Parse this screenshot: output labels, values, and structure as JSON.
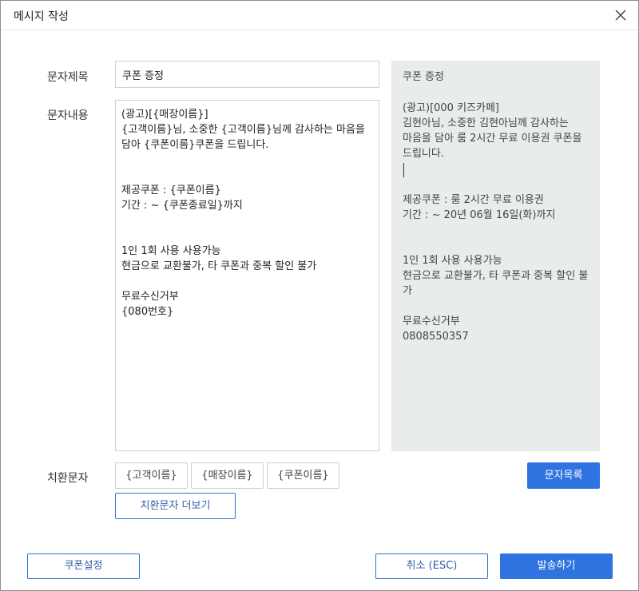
{
  "window": {
    "title": "메시지 작성"
  },
  "form": {
    "subject_label": "문자제목",
    "subject_value": "쿠폰 증정",
    "content_label": "문자내용",
    "content_value": "(광고)[{매장이름}]\n{고객이름}님, 소중한 {고객이름}님께 감사하는 마음을 담아 {쿠폰이름}쿠폰을 드립니다.\n\n\n제공쿠폰 : {쿠폰이름}\n기간 : ~ {쿠폰종료일}까지\n\n\n1인 1회 사용 사용가능\n현금으로 교환불가, 타 쿠폰과 중복 할인 불가\n\n무료수신거부\n{080번호}"
  },
  "preview": {
    "title": "쿠폰 증정",
    "body": "(광고)[000 키즈카페]\n김현아님, 소중한 김현아님께 감사하는 마음을 담아 룸 2시간 무료 이용권 쿠폰을 드립니다.",
    "after": "\n제공쿠폰 : 룸 2시간 무료 이용권\n기간 : ~ 20년 06월 16일(화)까지\n\n\n1인 1회 사용 사용가능\n현금으로 교환불가, 타 쿠폰과 중복 할인 불가\n\n무료수신거부\n0808550357"
  },
  "substitution": {
    "label": "치환문자",
    "tags": [
      "{고객이름}",
      "{매장이름}",
      "{쿠폰이름}"
    ],
    "more_label": "치환문자 더보기"
  },
  "buttons": {
    "message_list": "문자목록",
    "coupon_settings": "쿠폰설정",
    "cancel": "취소 (ESC)",
    "send": "발송하기"
  },
  "icons": {
    "close": "close-icon"
  },
  "colors": {
    "primary": "#2f73e0",
    "preview_bg": "#e9ecec"
  }
}
